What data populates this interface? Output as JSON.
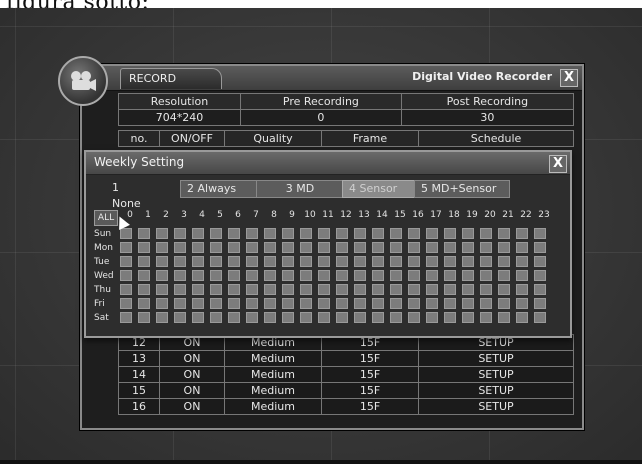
{
  "caption": "figura sotto:",
  "record_window": {
    "tab_label": "RECORD",
    "title": "Digital Video Recorder",
    "close_label": "X",
    "resolution_header": "Resolution",
    "pre_header": "Pre Recording",
    "post_header": "Post Recording",
    "resolution_value": "704*240",
    "pre_value": "0",
    "post_value": "30",
    "columns": [
      "no.",
      "ON/OFF",
      "Quality",
      "Frame",
      "Schedule"
    ],
    "rows": [
      {
        "no": "12",
        "onoff": "ON",
        "quality": "Medium",
        "frame": "15F",
        "schedule": "SETUP"
      },
      {
        "no": "13",
        "onoff": "ON",
        "quality": "Medium",
        "frame": "15F",
        "schedule": "SETUP"
      },
      {
        "no": "14",
        "onoff": "ON",
        "quality": "Medium",
        "frame": "15F",
        "schedule": "SETUP"
      },
      {
        "no": "15",
        "onoff": "ON",
        "quality": "Medium",
        "frame": "15F",
        "schedule": "SETUP"
      },
      {
        "no": "16",
        "onoff": "ON",
        "quality": "Medium",
        "frame": "15F",
        "schedule": "SETUP"
      }
    ]
  },
  "weekly": {
    "title": "Weekly Setting",
    "close_label": "X",
    "modes": [
      "1 None",
      "2 Always",
      "3 MD",
      "4 Sensor",
      "5 MD+Sensor"
    ],
    "selected_mode": "4 Sensor",
    "all_label": "ALL",
    "hours": [
      "0",
      "1",
      "2",
      "3",
      "4",
      "5",
      "6",
      "7",
      "8",
      "9",
      "10",
      "11",
      "12",
      "13",
      "14",
      "15",
      "16",
      "17",
      "18",
      "19",
      "20",
      "21",
      "22",
      "23"
    ],
    "days": [
      "Sun",
      "Mon",
      "Tue",
      "Wed",
      "Thu",
      "Fri",
      "Sat"
    ]
  },
  "icons": {
    "camera": "camera-icon",
    "cursor": "mouse-pointer-icon"
  },
  "colors": {
    "panel": "#1e1e1e",
    "cell": "#7c7c7c",
    "border": "#8a8a8a"
  }
}
